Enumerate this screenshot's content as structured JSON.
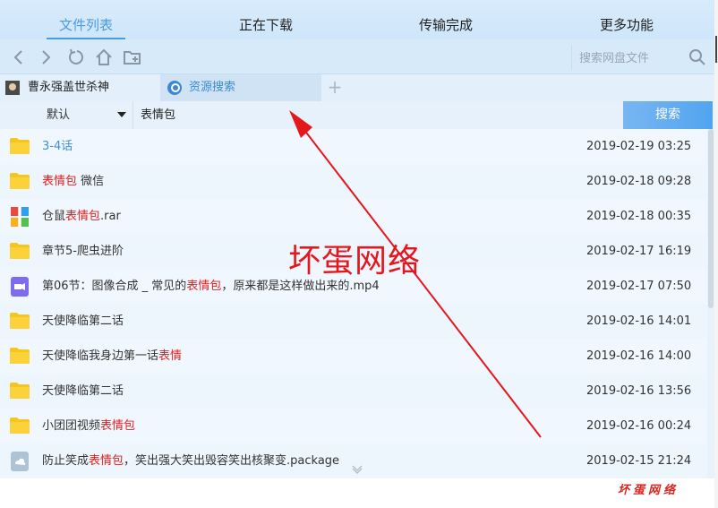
{
  "tabs": [
    {
      "label": "文件列表",
      "active": true
    },
    {
      "label": "正在下载",
      "active": false
    },
    {
      "label": "传输完成",
      "active": false
    },
    {
      "label": "更多功能",
      "active": false
    }
  ],
  "toolbar": {
    "icons": [
      "back-icon",
      "forward-icon",
      "refresh-icon",
      "home-icon",
      "new-folder-icon"
    ],
    "search_placeholder": "搜索网盘文件"
  },
  "file_tabs": {
    "user_tab_label": "曹永强盖世杀神",
    "search_tab_label": "资源搜索",
    "add_tab": "+"
  },
  "filter": {
    "sort_label": "默认",
    "keyword": "表情包",
    "search_button": "搜索"
  },
  "files": [
    {
      "icon": "folder-icon",
      "name_pre": "3-4话",
      "hl": "",
      "name_post": "",
      "date": "2019-02-19 03:25",
      "blue": true
    },
    {
      "icon": "folder-icon",
      "name_pre": "",
      "hl": "表情包",
      "name_post": " 微信",
      "date": "2019-02-18 09:28",
      "blue": false
    },
    {
      "icon": "archive-icon",
      "name_pre": "仓鼠",
      "hl": "表情包",
      "name_post": ".rar",
      "date": "2019-02-18 00:35",
      "blue": false
    },
    {
      "icon": "folder-icon",
      "name_pre": "章节5-爬虫进阶",
      "hl": "",
      "name_post": "",
      "date": "2019-02-17 16:19",
      "blue": false
    },
    {
      "icon": "video-icon",
      "name_pre": "第06节：图像合成 _ 常见的",
      "hl": "表情包",
      "name_post": "，原来都是这样做出来的.mp4",
      "date": "2019-02-17 07:50",
      "blue": false
    },
    {
      "icon": "folder-icon",
      "name_pre": "天使降临第二话",
      "hl": "",
      "name_post": "",
      "date": "2019-02-16 14:01",
      "blue": false
    },
    {
      "icon": "folder-icon",
      "name_pre": "天使降临我身边第一话",
      "hl": "表情",
      "name_post": "",
      "date": "2019-02-16 14:00",
      "blue": false
    },
    {
      "icon": "folder-icon",
      "name_pre": "天使降临第二话",
      "hl": "",
      "name_post": "",
      "date": "2019-02-16 13:56",
      "blue": false
    },
    {
      "icon": "folder-icon",
      "name_pre": "小团团视频",
      "hl": "表情包",
      "name_post": "",
      "date": "2019-02-16 00:24",
      "blue": false
    },
    {
      "icon": "package-icon",
      "name_pre": "防止笑成",
      "hl": "表情包",
      "name_post": "，笑出强大笑出毁容笑出核聚变.package",
      "date": "2019-02-15 21:24",
      "blue": false
    }
  ],
  "watermark_big": "坏蛋网络",
  "watermark_small": "坏蛋网络",
  "colors": {
    "accent": "#4a9ce0",
    "highlight": "#e0201e",
    "folder": "#f5c518",
    "arrow": "#e4171c"
  }
}
